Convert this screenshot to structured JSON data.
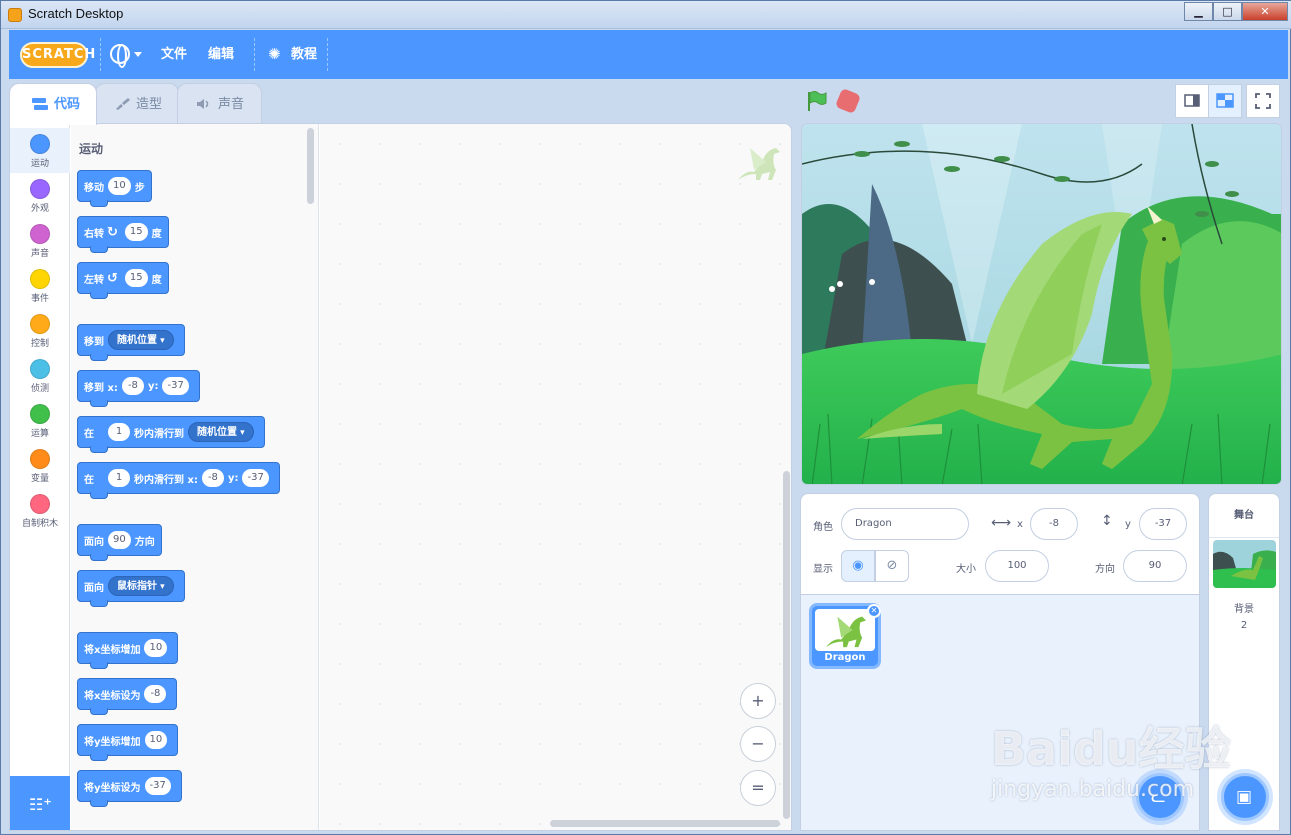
{
  "window": {
    "title": "Scratch Desktop",
    "min": "▁",
    "max": "□",
    "close": "✕"
  },
  "menubar": {
    "logo_text": "SCRATCH",
    "file": "文件",
    "edit": "编辑",
    "tutorials": "教程"
  },
  "tabs": [
    {
      "label": "代码",
      "icon": "code-icon"
    },
    {
      "label": "造型",
      "icon": "brush-icon"
    },
    {
      "label": "声音",
      "icon": "speaker-icon"
    }
  ],
  "categories": [
    {
      "label": "运动",
      "color": "#4c97ff"
    },
    {
      "label": "外观",
      "color": "#9966ff"
    },
    {
      "label": "声音",
      "color": "#cf63cf"
    },
    {
      "label": "事件",
      "color": "#ffd500"
    },
    {
      "label": "控制",
      "color": "#ffab19"
    },
    {
      "label": "侦测",
      "color": "#4cbfe6"
    },
    {
      "label": "运算",
      "color": "#40bf4a"
    },
    {
      "label": "变量",
      "color": "#ff8c1a"
    },
    {
      "label": "自制积木",
      "color": "#ff6680"
    }
  ],
  "palette": {
    "heading": "运动",
    "blocks": {
      "move": {
        "a": "移动",
        "v": "10",
        "b": "步"
      },
      "turn_right": {
        "a": "右转",
        "v": "15",
        "b": "度"
      },
      "turn_left": {
        "a": "左转",
        "v": "15",
        "b": "度"
      },
      "goto": {
        "a": "移到",
        "dd": "随机位置"
      },
      "goto_xy": {
        "a": "移到 x:",
        "x": "-8",
        "b": "y:",
        "y": "-37"
      },
      "glide": {
        "a": "在",
        "v": "1",
        "b": "秒内滑行到",
        "dd": "随机位置"
      },
      "glide_xy": {
        "a": "在",
        "v": "1",
        "b": "秒内滑行到 x:",
        "x": "-8",
        "c": "y:",
        "y": "-37"
      },
      "point_dir": {
        "a": "面向",
        "v": "90",
        "b": "方向"
      },
      "point_towards": {
        "a": "面向",
        "dd": "鼠标指针"
      },
      "change_x": {
        "a": "将x坐标增加",
        "v": "10"
      },
      "set_x": {
        "a": "将x坐标设为",
        "v": "-8"
      },
      "change_y": {
        "a": "将y坐标增加",
        "v": "10"
      },
      "set_y": {
        "a": "将y坐标设为",
        "v": "-37"
      }
    }
  },
  "zoom": {
    "in": "+",
    "out": "−",
    "reset": "="
  },
  "sprite_info": {
    "sprite_label": "角色",
    "sprite_name": "Dragon",
    "x_label": "x",
    "x_value": "-8",
    "y_label": "y",
    "y_value": "-37",
    "show_label": "显示",
    "size_label": "大小",
    "size_value": "100",
    "direction_label": "方向",
    "direction_value": "90"
  },
  "sprites": [
    {
      "name": "Dragon"
    }
  ],
  "stage_panel": {
    "heading": "舞台",
    "backdrops_label": "背景",
    "backdrops_count": "2"
  },
  "watermark": {
    "main": "Baidu经验",
    "sub": "jingyan.baidu.com"
  },
  "colors": {
    "accent": "#4c97ff",
    "menubar": "#4c97ff",
    "stop": "#ec5959",
    "flag": "#4cbf56"
  }
}
